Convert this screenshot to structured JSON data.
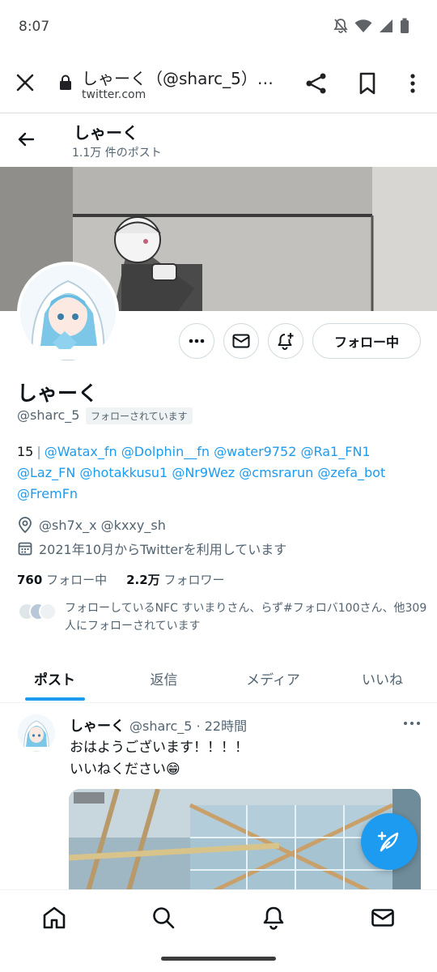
{
  "status_bar": {
    "time": "8:07",
    "icons": [
      "notifications-off-icon",
      "wifi-icon",
      "signal-icon",
      "battery-icon"
    ]
  },
  "custom_tab": {
    "title": "しゃーく（@sharc_5）…",
    "url": "twitter.com",
    "icons": [
      "close-icon",
      "lock-icon",
      "share-icon",
      "bookmark-icon",
      "more-vert-icon"
    ]
  },
  "header": {
    "name": "しゃーく",
    "post_count": "1.1万 件のポスト"
  },
  "profile": {
    "name": "しゃーく",
    "handle": "@sharc_5",
    "follows_you_badge": "フォローされています",
    "follow_button_label": "フォロー中",
    "bio_prefix": "15",
    "bio_mentions": [
      "@Watax_fn",
      "@Dolphin__fn",
      "@water9752",
      "@Ra1_FN1",
      "@Laz_FN",
      "@hotakkusu1",
      "@Nr9Wez",
      "@cmsrarun",
      "@zefa_bot",
      "@FremFn"
    ],
    "location": "@sh7x_x @kxxy_sh",
    "joined": "2021年10月からTwitterを利用しています",
    "following_count": "760",
    "following_label": "フォロー中",
    "followers_count": "2.2万",
    "followers_label": "フォロワー",
    "followed_by": "フォローしているNFC すいまりさん、らず#フォロバ100さん、他309人にフォローされています"
  },
  "tabs": [
    {
      "label": "ポスト",
      "active": true
    },
    {
      "label": "返信",
      "active": false
    },
    {
      "label": "メディア",
      "active": false
    },
    {
      "label": "いいね",
      "active": false
    }
  ],
  "tweet": {
    "name": "しゃーく",
    "handle": "@sharc_5",
    "time": "· 22時間",
    "line1": "おはようございます！！！！",
    "line2": "いいねください😁"
  },
  "bottom_nav": [
    "home-icon",
    "search-icon",
    "notifications-icon",
    "messages-icon"
  ],
  "colors": {
    "accent": "#1d9bf0",
    "text": "#0f1419",
    "secondary_text": "#536471"
  }
}
